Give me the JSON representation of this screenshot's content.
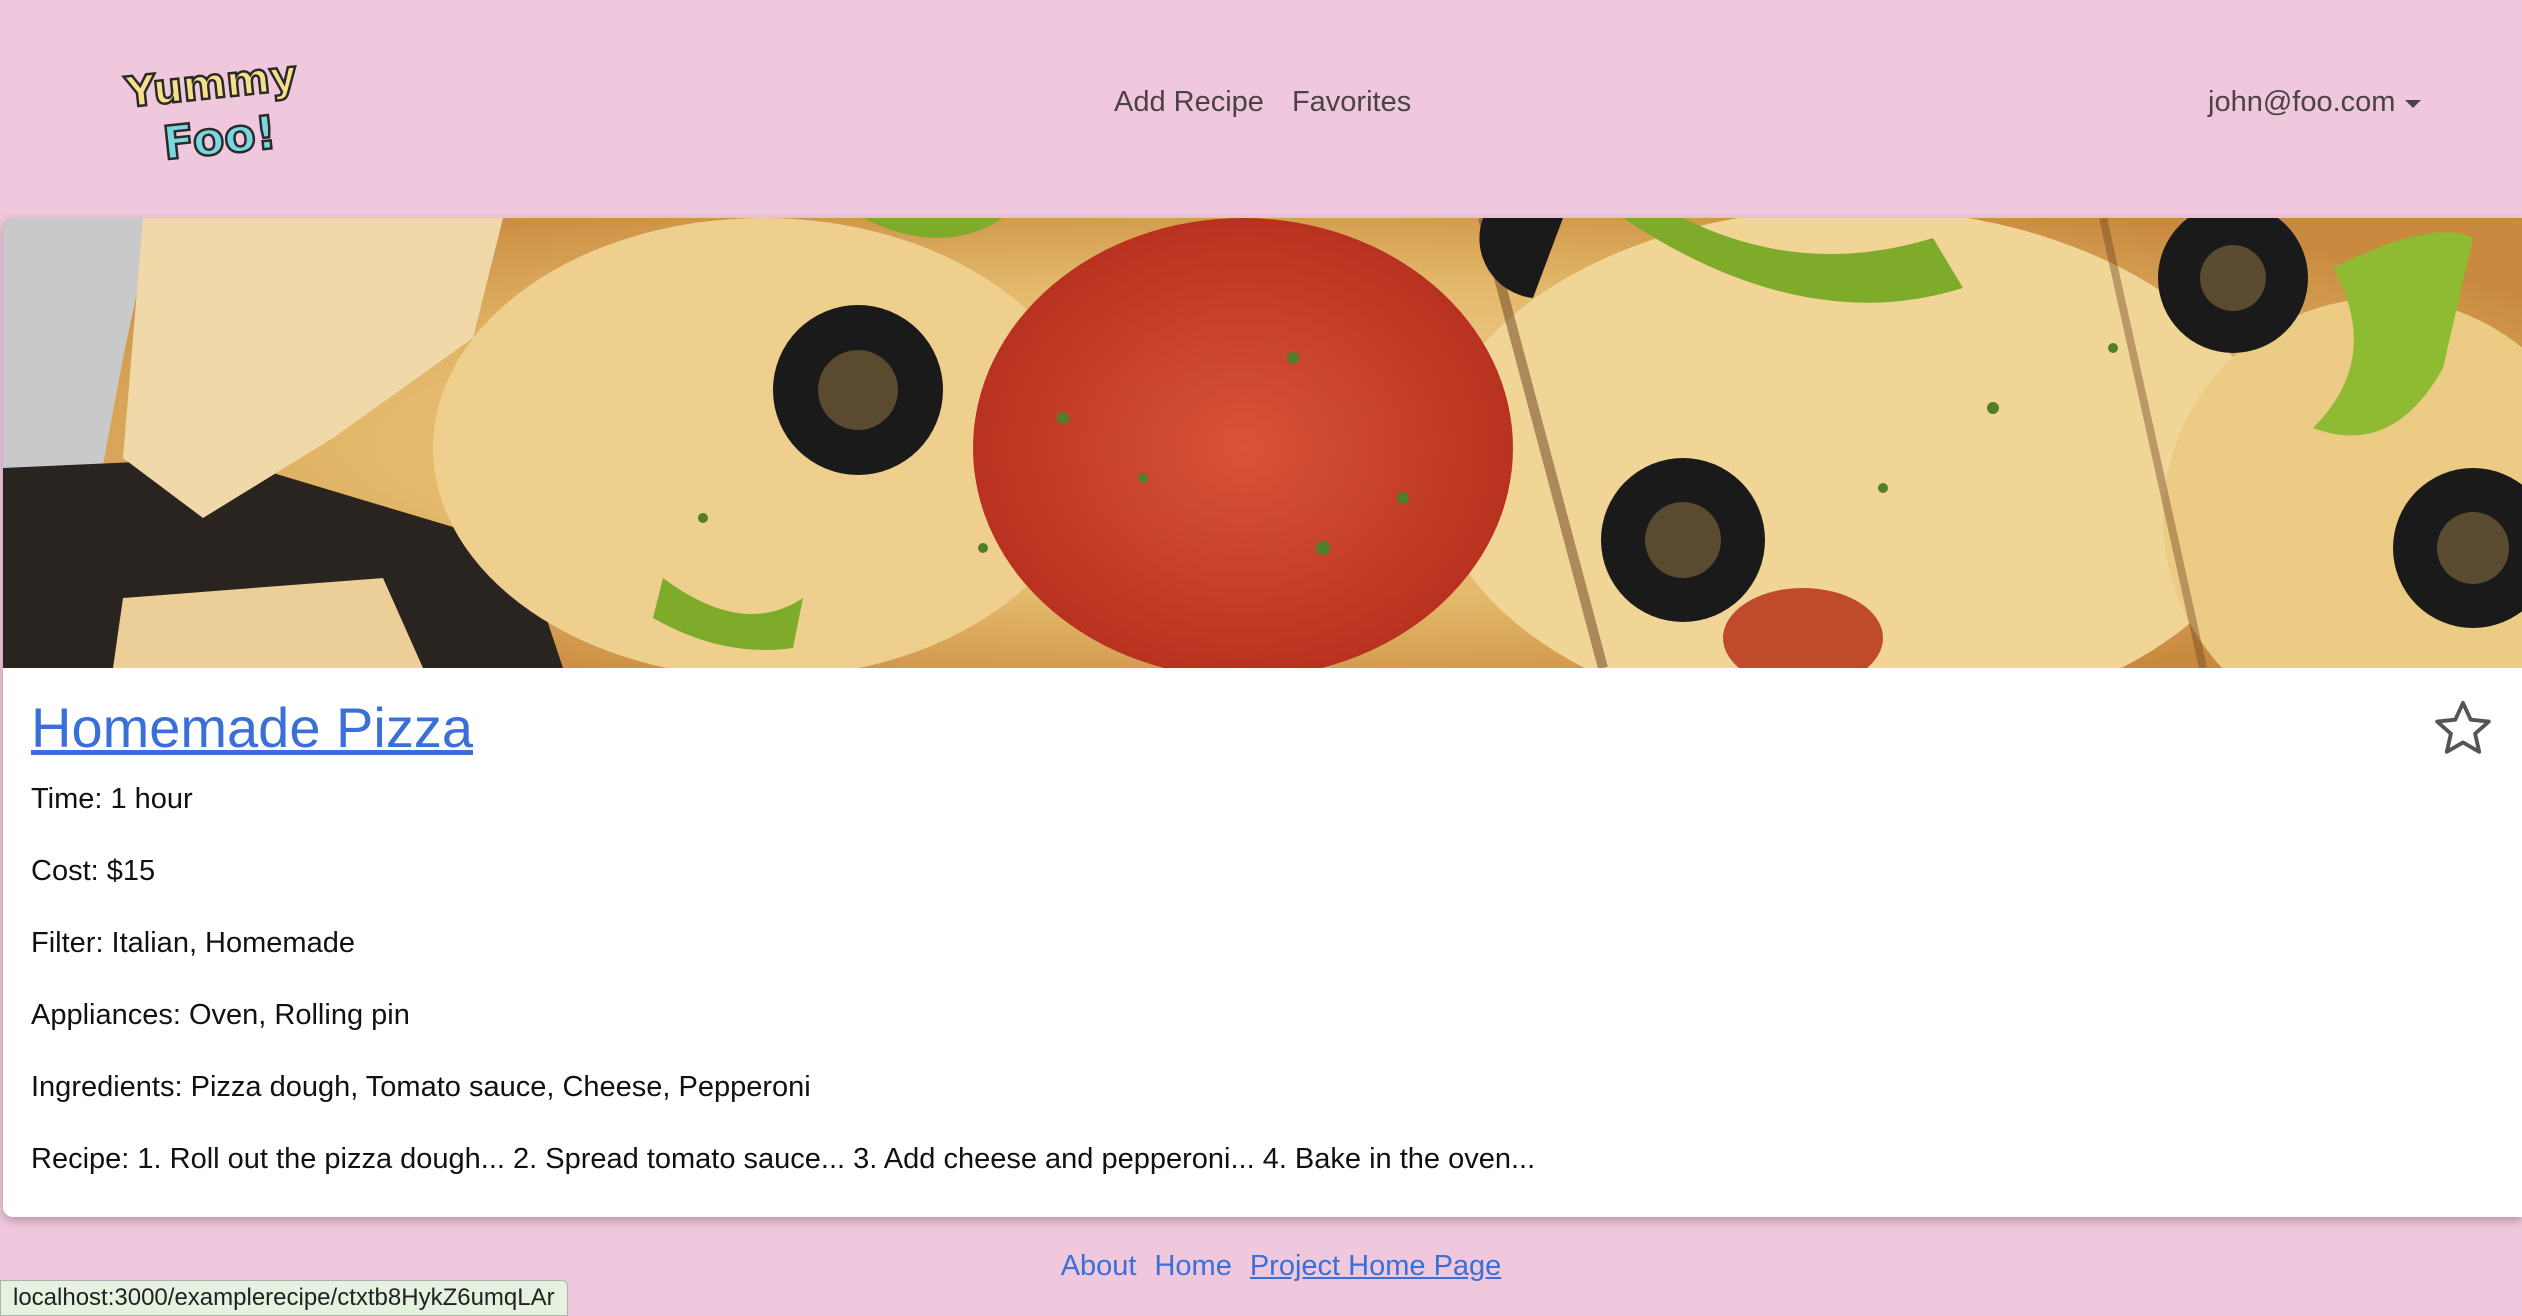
{
  "navbar": {
    "logo_text_top": "Yummy",
    "logo_text_bottom": "Foo!",
    "links": [
      "Add Recipe",
      "Favorites"
    ],
    "user_email": "john@foo.com"
  },
  "recipe": {
    "title": "Homemade Pizza",
    "time": "Time: 1 hour",
    "cost": "Cost: $15",
    "filter": "Filter: Italian, Homemade",
    "appliances": "Appliances: Oven, Rolling pin",
    "ingredients": "Ingredients: Pizza dough, Tomato sauce, Cheese, Pepperoni",
    "instructions": "Recipe: 1. Roll out the pizza dough... 2. Spread tomato sauce... 3. Add cheese and pepperoni... 4. Bake in the oven..."
  },
  "footer": {
    "about": "About",
    "home": "Home",
    "project_home": "Project Home Page"
  },
  "status_bar": {
    "url": "localhost:3000/examplerecipe/ctxtb8HykZ6umqLAr"
  },
  "icons": {
    "favorite": "star-outline-icon",
    "user_menu": "caret-down-icon"
  },
  "colors": {
    "background": "#f0c8dd",
    "link": "#3a6fd8"
  }
}
